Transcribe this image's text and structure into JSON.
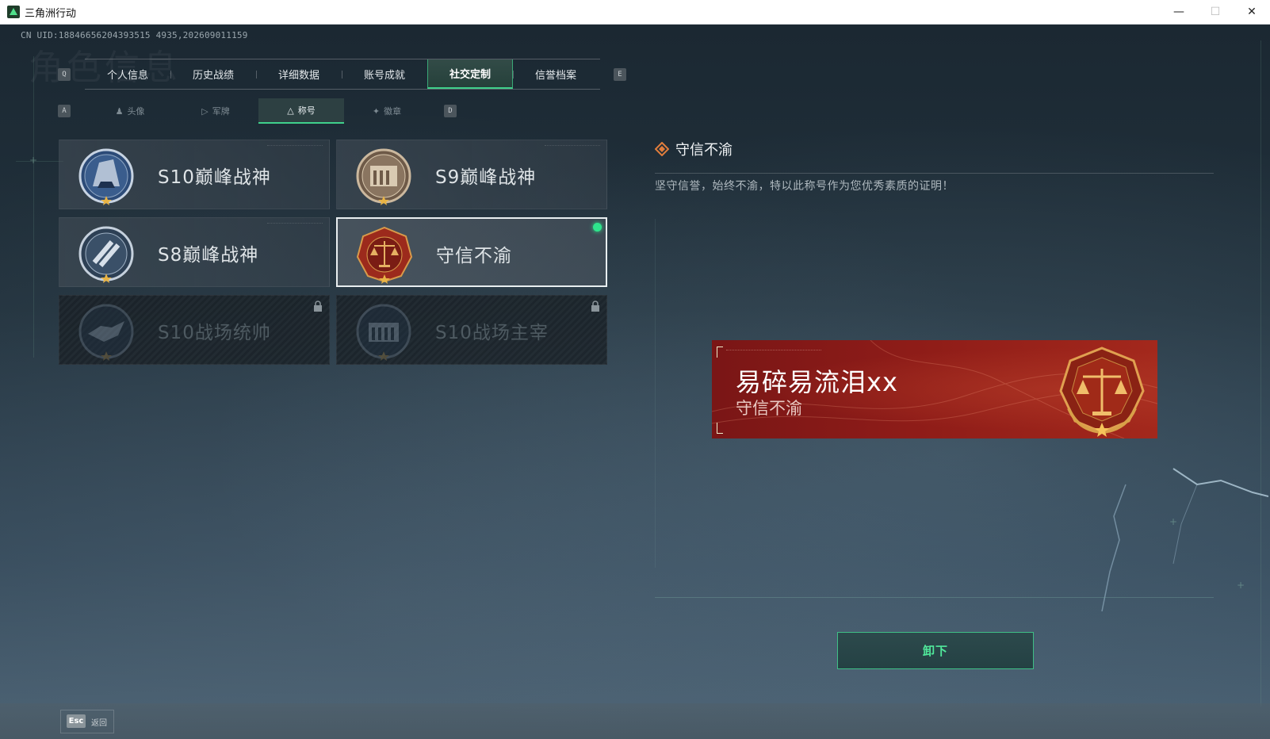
{
  "window": {
    "title": "三角洲行动",
    "minimize": "—",
    "maximize": "☐",
    "close": "✕"
  },
  "uid": "CN UID:18846656204393515 4935,202609011159",
  "ghost_title": "角色信息",
  "main_tabs": {
    "left_key": "Q",
    "right_key": "E",
    "items": [
      {
        "label": "个人信息"
      },
      {
        "label": "历史战绩"
      },
      {
        "label": "详细数据"
      },
      {
        "label": "账号成就"
      },
      {
        "label": "社交定制",
        "active": true
      },
      {
        "label": "信誉档案"
      }
    ]
  },
  "sub_tabs": {
    "left_key": "A",
    "right_key": "D",
    "items": [
      {
        "label": "头像",
        "icon": "person-icon"
      },
      {
        "label": "军牌",
        "icon": "dogtag-icon"
      },
      {
        "label": "称号",
        "icon": "title-icon",
        "active": true
      },
      {
        "label": "徽章",
        "icon": "badge-icon"
      }
    ]
  },
  "titles": [
    {
      "label": "S10巅峰战神",
      "locked": false,
      "selected": false,
      "equipped": false
    },
    {
      "label": "S9巅峰战神",
      "locked": false,
      "selected": false,
      "equipped": false
    },
    {
      "label": "S8巅峰战神",
      "locked": false,
      "selected": false,
      "equipped": false
    },
    {
      "label": "守信不渝",
      "locked": false,
      "selected": true,
      "equipped": true
    },
    {
      "label": "S10战场统帅",
      "locked": true,
      "selected": false,
      "equipped": false
    },
    {
      "label": "S10战场主宰",
      "locked": true,
      "selected": false,
      "equipped": false
    }
  ],
  "detail": {
    "title": "守信不渝",
    "description": "坚守信誉，始终不渝，特以此称号作为您优秀素质的证明！"
  },
  "banner": {
    "player_name": "易碎易流泪xx",
    "title": "守信不渝"
  },
  "unequip_label": "卸下",
  "footer": {
    "esc_key": "Esc",
    "back_label": "返回"
  },
  "colors": {
    "accent": "#3fd08b",
    "banner_red": "#8e1c18",
    "gold": "#d9a24a"
  }
}
